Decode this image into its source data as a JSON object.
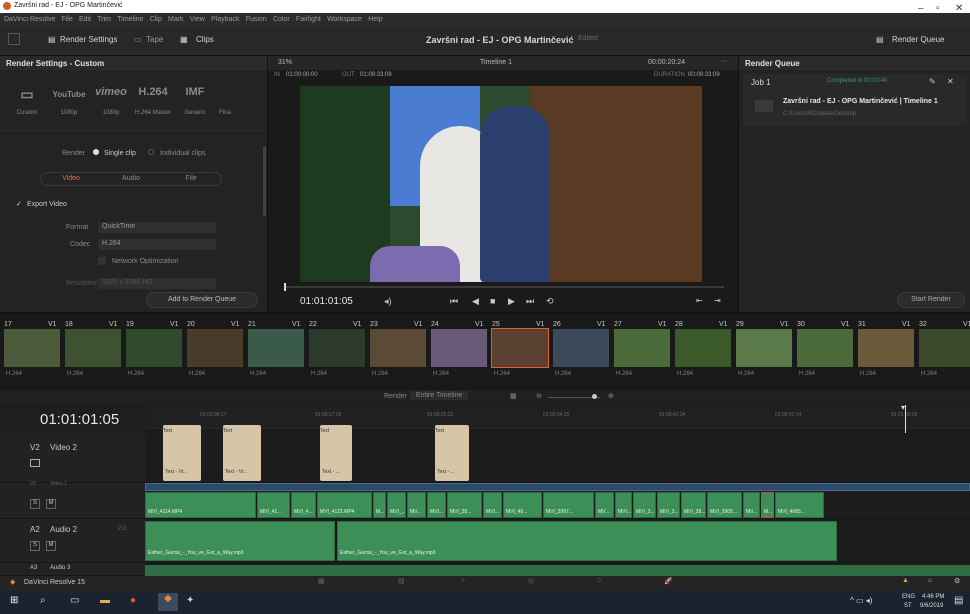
{
  "window": {
    "title": "Završni rad - EJ - OPG Martinčević",
    "menu": [
      "DaVinci Resolve",
      "File",
      "Edit",
      "Trim",
      "Timeline",
      "Clip",
      "Mark",
      "View",
      "Playback",
      "Fusion",
      "Color",
      "Fairlight",
      "Workspace",
      "Help"
    ]
  },
  "toolbar": {
    "render_settings": "Render Settings",
    "tape": "Tape",
    "clips": "Clips",
    "project_title": "Završni rad - EJ - OPG Martinčević",
    "edited": "Edited",
    "render_queue": "Render Queue"
  },
  "render_settings": {
    "header": "Render Settings - Custom",
    "formats": [
      {
        "logo": "▭",
        "label": "Custom"
      },
      {
        "logo": "YouTube",
        "label": "1080p"
      },
      {
        "logo": "vimeo",
        "label": "1080p"
      },
      {
        "logo": "H.264",
        "label": "H.264 Master"
      },
      {
        "logo": "IMF",
        "label": "Generic"
      }
    ],
    "fina": "Fina",
    "render_label": "Render",
    "single_clip": "Single clip",
    "individual_clips": "Individual clips",
    "tabs": [
      "Video",
      "Audio",
      "File"
    ],
    "export_video": "Export Video",
    "format_label": "Format",
    "format_value": "QuickTime",
    "codec_label": "Codec",
    "codec_value": "H.264",
    "network_opt": "Network Optimization",
    "resolution_label": "Resolution",
    "resolution_value": "1920 x 1080 HD",
    "add_to_queue": "Add to Render Queue"
  },
  "viewer": {
    "zoom": "31%",
    "timeline_name": "Timeline 1",
    "timecode_top": "00:00:20:24",
    "in_label": "IN",
    "in_value": "01:00:00:00",
    "out_label": "OUT",
    "out_value": "01:09:33:08",
    "duration_label": "DURATION",
    "duration_value": "00:09:33:09",
    "current_tc": "01:01:01:05"
  },
  "queue": {
    "header": "Render Queue",
    "job": "Job 1",
    "job_status": "Completed in 00:03:40",
    "job_title": "Završni rad - EJ - OPG Martinčević | Timeline 1",
    "job_path": "C:\\Users\\Elizabeta\\Desktop",
    "start_render": "Start Render"
  },
  "filmstrip": {
    "clips": [
      {
        "num": "17",
        "track": "V1",
        "codec": "H.264"
      },
      {
        "num": "18",
        "track": "V1",
        "codec": "H.264"
      },
      {
        "num": "19",
        "track": "V1",
        "codec": "H.264"
      },
      {
        "num": "20",
        "track": "V1",
        "codec": "H.264"
      },
      {
        "num": "21",
        "track": "V1",
        "codec": "H.264"
      },
      {
        "num": "22",
        "track": "V1",
        "codec": "H.264"
      },
      {
        "num": "23",
        "track": "V1",
        "codec": "H.264"
      },
      {
        "num": "24",
        "track": "V1",
        "codec": "H.264"
      },
      {
        "num": "25",
        "track": "V1",
        "codec": "H.264"
      },
      {
        "num": "26",
        "track": "V1",
        "codec": "H.264"
      },
      {
        "num": "27",
        "track": "V1",
        "codec": "H.264"
      },
      {
        "num": "28",
        "track": "V1",
        "codec": "H.264"
      },
      {
        "num": "29",
        "track": "V1",
        "codec": "H.264"
      },
      {
        "num": "30",
        "track": "V1",
        "codec": "H.264"
      },
      {
        "num": "31",
        "track": "V1",
        "codec": "H.264"
      },
      {
        "num": "32",
        "track": "V1",
        "codec": "H.264"
      }
    ],
    "render_label": "Render",
    "render_range": "Entire Timeline"
  },
  "timeline": {
    "timecode": "01:01:01:05",
    "ticks": [
      "01:00:08:17",
      "01:00:17:03",
      "01:00:25:21",
      "01:00:34:15",
      "01:00:42:34",
      "01:00:51:14",
      "01:01:00:03"
    ],
    "tracks": [
      {
        "id": "V2",
        "name": "Video 2"
      },
      {
        "id": "V1",
        "name": "Video 1"
      },
      {
        "id": "A2",
        "name": "Audio 2",
        "level": "2.0"
      },
      {
        "id": "A3",
        "name": "Audio 3"
      }
    ],
    "gen_clips": [
      "Text",
      "Text",
      "Text",
      "Text"
    ],
    "gen_clip_labels": [
      "Text - Vr...",
      "Text - Vr...",
      "Text - ...",
      "Text - ..."
    ],
    "audio_clips": [
      "MVI_4114.MP4",
      "MVI_41...",
      "MVI_4...",
      "MVI_4121.MP4",
      "M...",
      "MVI_...",
      "MV...",
      "MVI...",
      "MVI_38...",
      "MVI...",
      "MVI_40...",
      "MVI_3997...",
      "MV...",
      "MVI...",
      "MVI_3...",
      "MVI_3...",
      "MVI_39...",
      "MVI_3905...",
      "MV...",
      "M...",
      "MVI_4065..."
    ],
    "music": [
      "Esther_Garcia_-_You_ve_Got_a_Way.mp3",
      "Esther_Garcia_-_You_ve_Got_a_Way.mp3"
    ]
  },
  "pagebar": {
    "app": "DaVinci Resolve 15"
  },
  "taskbar": {
    "lang": "ENG",
    "region": "ST",
    "time": "4:46 PM",
    "date": "9/6/2019"
  }
}
